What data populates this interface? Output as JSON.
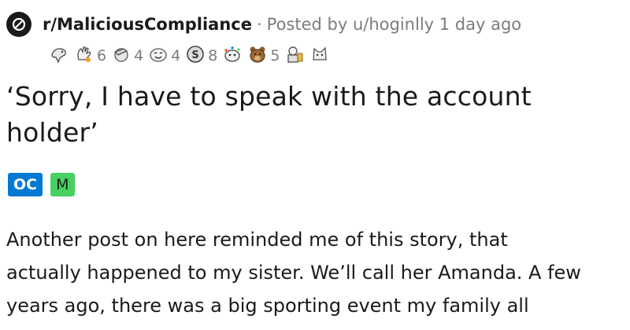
{
  "post": {
    "subreddit": "r/MaliciousCompliance",
    "separator": "·",
    "posted_by": "Posted by u/hoginlly 1 day ago",
    "title": "‘Sorry, I have to speak with the account holder’",
    "flairs": {
      "oc": "OC",
      "m": "M"
    },
    "body_lines": [
      "Another post on here reminded me of this story, that",
      "actually happened to my sister. We’ll call her Amanda. A few",
      "years ago, there was a big sporting event my family all"
    ]
  },
  "awards": [
    {
      "icon": "wholesome-seal-icon"
    },
    {
      "icon": "clapping-hand-icon",
      "count": "6"
    },
    {
      "icon": "face-palm-icon",
      "count": "4"
    },
    {
      "icon": "crying-laughing-face-icon",
      "count": "4"
    },
    {
      "icon": "silver-coin-icon",
      "count": "8"
    },
    {
      "icon": "snoo-party-icon"
    },
    {
      "icon": "brown-bear-icon",
      "count": "5"
    },
    {
      "icon": "snoo-trophy-icon"
    },
    {
      "icon": "cat-face-icon"
    }
  ],
  "colors": {
    "oc_flair": "#0079d3",
    "m_flair": "#46d160",
    "meta_text": "#7c7c7c",
    "text": "#1a1a1b"
  }
}
